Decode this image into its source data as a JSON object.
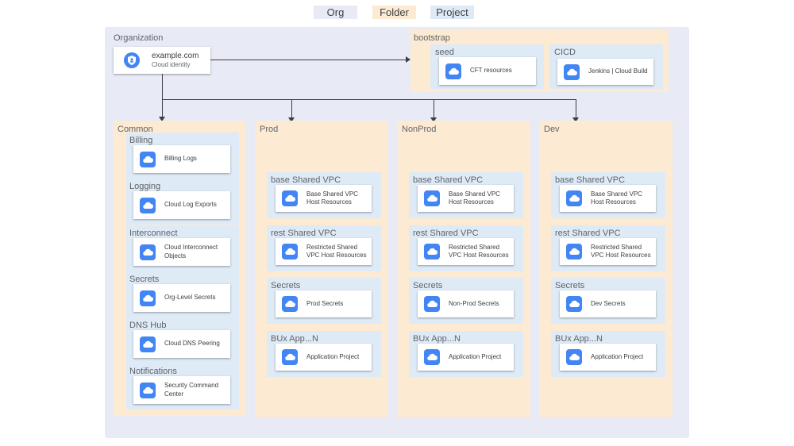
{
  "legend": {
    "org": "Org",
    "folder": "Folder",
    "project": "Project"
  },
  "colors": {
    "org": "#e8eaf6",
    "folder": "#fcebd2",
    "project": "#dfeaf7",
    "icon": "#4285f4"
  },
  "organization": {
    "label": "Organization",
    "name": "example.com",
    "sub": "Cloud identity"
  },
  "bootstrap": {
    "label": "bootstrap",
    "seed": {
      "label": "seed",
      "resource": "CFT resources"
    },
    "cicd": {
      "label": "CICD",
      "resource": "Jenkins | Cloud Build"
    }
  },
  "common": {
    "label": "Common",
    "projects": [
      {
        "label": "Billing",
        "resource": "Billing Logs"
      },
      {
        "label": "Logging",
        "resource": "Cloud Log Exports"
      },
      {
        "label": "Interconnect",
        "resource": "Cloud Interconnect\nObjects"
      },
      {
        "label": "Secrets",
        "resource": "Org-Level Secrets"
      },
      {
        "label": "DNS Hub",
        "resource": "Cloud DNS Peering"
      },
      {
        "label": "Notifications",
        "resource": "Security Command\nCenter"
      }
    ]
  },
  "envs": [
    {
      "label": "Prod",
      "projects": [
        {
          "label": "base Shared VPC",
          "resource": "Base Shared VPC\nHost Resources"
        },
        {
          "label": "rest Shared VPC",
          "resource": "Restricted Shared\nVPC Host Resources"
        },
        {
          "label": "Secrets",
          "resource": "Prod Secrets"
        },
        {
          "label": "BUx App...N",
          "resource": "Application Project"
        }
      ]
    },
    {
      "label": "NonProd",
      "projects": [
        {
          "label": "base Shared VPC",
          "resource": "Base Shared VPC\nHost Resources"
        },
        {
          "label": "rest Shared VPC",
          "resource": "Restricted Shared\nVPC Host Resources"
        },
        {
          "label": "Secrets",
          "resource": "Non-Prod Secrets"
        },
        {
          "label": "BUx App...N",
          "resource": "Application Project"
        }
      ]
    },
    {
      "label": "Dev",
      "projects": [
        {
          "label": "base Shared VPC",
          "resource": "Base Shared VPC\nHost Resources"
        },
        {
          "label": "rest Shared VPC",
          "resource": "Restricted Shared\nVPC Host Resources"
        },
        {
          "label": "Secrets",
          "resource": "Dev Secrets"
        },
        {
          "label": "BUx App...N",
          "resource": "Application Project"
        }
      ]
    }
  ]
}
